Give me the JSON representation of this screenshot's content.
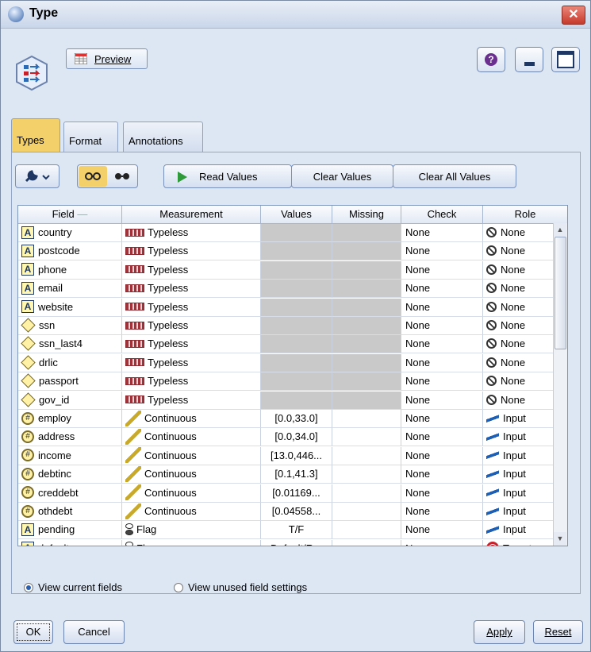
{
  "window": {
    "title": "Type",
    "close_label": "✕"
  },
  "toolbar": {
    "preview_label": "Preview",
    "help_label": "?"
  },
  "tabs": [
    {
      "label": "Types",
      "active": true
    },
    {
      "label": "Format",
      "active": false
    },
    {
      "label": "Annotations",
      "active": false
    }
  ],
  "actions": {
    "read_values": "Read Values",
    "clear_values": "Clear Values",
    "clear_all_values": "Clear All Values"
  },
  "table": {
    "headers": {
      "field": "Field",
      "measurement": "Measurement",
      "values": "Values",
      "missing": "Missing",
      "check": "Check",
      "role": "Role"
    },
    "rows": [
      {
        "field": "country",
        "ftype": "A",
        "measurement": "Typeless",
        "mtype": "typeless",
        "values": "",
        "missing": "",
        "check": "None",
        "role": "None",
        "rtype": "none"
      },
      {
        "field": "postcode",
        "ftype": "A",
        "measurement": "Typeless",
        "mtype": "typeless",
        "values": "",
        "missing": "",
        "check": "None",
        "role": "None",
        "rtype": "none"
      },
      {
        "field": "phone",
        "ftype": "A",
        "measurement": "Typeless",
        "mtype": "typeless",
        "values": "",
        "missing": "",
        "check": "None",
        "role": "None",
        "rtype": "none"
      },
      {
        "field": "email",
        "ftype": "A",
        "measurement": "Typeless",
        "mtype": "typeless",
        "values": "",
        "missing": "",
        "check": "None",
        "role": "None",
        "rtype": "none"
      },
      {
        "field": "website",
        "ftype": "A",
        "measurement": "Typeless",
        "mtype": "typeless",
        "values": "",
        "missing": "",
        "check": "None",
        "role": "None",
        "rtype": "none"
      },
      {
        "field": "ssn",
        "ftype": "diamond",
        "measurement": "Typeless",
        "mtype": "typeless",
        "values": "",
        "missing": "",
        "check": "None",
        "role": "None",
        "rtype": "none"
      },
      {
        "field": "ssn_last4",
        "ftype": "diamond",
        "measurement": "Typeless",
        "mtype": "typeless",
        "values": "",
        "missing": "",
        "check": "None",
        "role": "None",
        "rtype": "none"
      },
      {
        "field": "drlic",
        "ftype": "diamond",
        "measurement": "Typeless",
        "mtype": "typeless",
        "values": "",
        "missing": "",
        "check": "None",
        "role": "None",
        "rtype": "none"
      },
      {
        "field": "passport",
        "ftype": "diamond",
        "measurement": "Typeless",
        "mtype": "typeless",
        "values": "",
        "missing": "",
        "check": "None",
        "role": "None",
        "rtype": "none"
      },
      {
        "field": "gov_id",
        "ftype": "diamond",
        "measurement": "Typeless",
        "mtype": "typeless",
        "values": "",
        "missing": "",
        "check": "None",
        "role": "None",
        "rtype": "none"
      },
      {
        "field": "employ",
        "ftype": "numeric",
        "measurement": "Continuous",
        "mtype": "continuous",
        "values": "[0.0,33.0]",
        "missing": "",
        "check": "None",
        "role": "Input",
        "rtype": "input"
      },
      {
        "field": "address",
        "ftype": "numeric",
        "measurement": "Continuous",
        "mtype": "continuous",
        "values": "[0.0,34.0]",
        "missing": "",
        "check": "None",
        "role": "Input",
        "rtype": "input"
      },
      {
        "field": "income",
        "ftype": "numeric",
        "measurement": "Continuous",
        "mtype": "continuous",
        "values": "[13.0,446...",
        "missing": "",
        "check": "None",
        "role": "Input",
        "rtype": "input"
      },
      {
        "field": "debtinc",
        "ftype": "numeric",
        "measurement": "Continuous",
        "mtype": "continuous",
        "values": "[0.1,41.3]",
        "missing": "",
        "check": "None",
        "role": "Input",
        "rtype": "input"
      },
      {
        "field": "creddebt",
        "ftype": "numeric",
        "measurement": "Continuous",
        "mtype": "continuous",
        "values": "[0.01169...",
        "missing": "",
        "check": "None",
        "role": "Input",
        "rtype": "input"
      },
      {
        "field": "othdebt",
        "ftype": "numeric",
        "measurement": "Continuous",
        "mtype": "continuous",
        "values": "[0.04558...",
        "missing": "",
        "check": "None",
        "role": "Input",
        "rtype": "input"
      },
      {
        "field": "pending",
        "ftype": "A",
        "measurement": "Flag",
        "mtype": "flag",
        "values": "T/F",
        "missing": "",
        "check": "None",
        "role": "Input",
        "rtype": "input"
      },
      {
        "field": "default",
        "ftype": "A",
        "measurement": "Flag",
        "mtype": "flag",
        "values": "Default/R...",
        "missing": "",
        "check": "None",
        "role": "Target",
        "rtype": "target"
      }
    ]
  },
  "view_options": {
    "current": {
      "label": "View current fields",
      "selected": true
    },
    "unused": {
      "label": "View unused field settings",
      "selected": false
    }
  },
  "buttons": {
    "ok": "OK",
    "cancel": "Cancel",
    "apply": "Apply",
    "reset": "Reset"
  }
}
